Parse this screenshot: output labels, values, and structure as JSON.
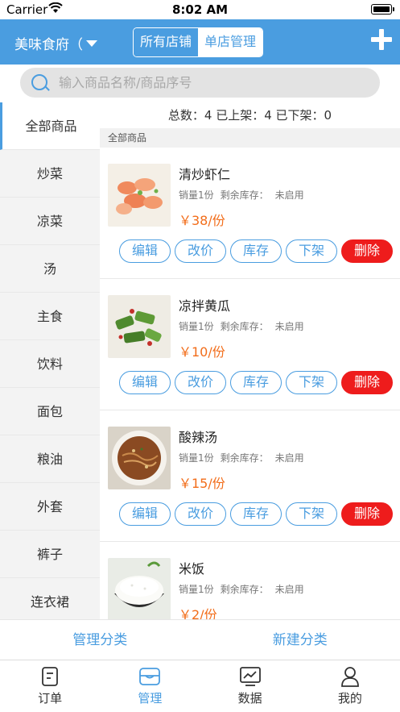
{
  "status": {
    "carrier": "Carrier",
    "time": "8:02 AM"
  },
  "nav": {
    "store_name": "美味食府（",
    "segments": [
      "所有店铺",
      "单店管理"
    ]
  },
  "search": {
    "placeholder": "输入商品名称/商品序号"
  },
  "sidebar": {
    "items": [
      "全部商品",
      "炒菜",
      "凉菜",
      "汤",
      "主食",
      "饮料",
      "面包",
      "粮油",
      "外套",
      "裤子",
      "连衣裙"
    ]
  },
  "summary": "总数：4 已上架：4 已下架：0",
  "category_header": "全部商品",
  "products": [
    {
      "name": "清炒虾仁",
      "sales": "销量1份",
      "stock_label": "剩余库存：",
      "stock_value": "未启用",
      "price": "￥38/份"
    },
    {
      "name": "凉拌黄瓜",
      "sales": "销量1份",
      "stock_label": "剩余库存：",
      "stock_value": "未启用",
      "price": "￥10/份"
    },
    {
      "name": "酸辣汤",
      "sales": "销量1份",
      "stock_label": "剩余库存：",
      "stock_value": "未启用",
      "price": "￥15/份"
    },
    {
      "name": "米饭",
      "sales": "销量1份",
      "stock_label": "剩余库存：",
      "stock_value": "未启用",
      "price": "￥2/份"
    }
  ],
  "buttons": {
    "edit": "编辑",
    "price": "改价",
    "stock": "库存",
    "off": "下架",
    "delete": "删除"
  },
  "bottom_actions": {
    "manage_category": "管理分类",
    "new_category": "新建分类"
  },
  "tabs": [
    "订单",
    "管理",
    "数据",
    "我的"
  ],
  "colors": {
    "accent": "#4a9de0",
    "price": "#f26d1a",
    "delete": "#ee1c1c"
  }
}
